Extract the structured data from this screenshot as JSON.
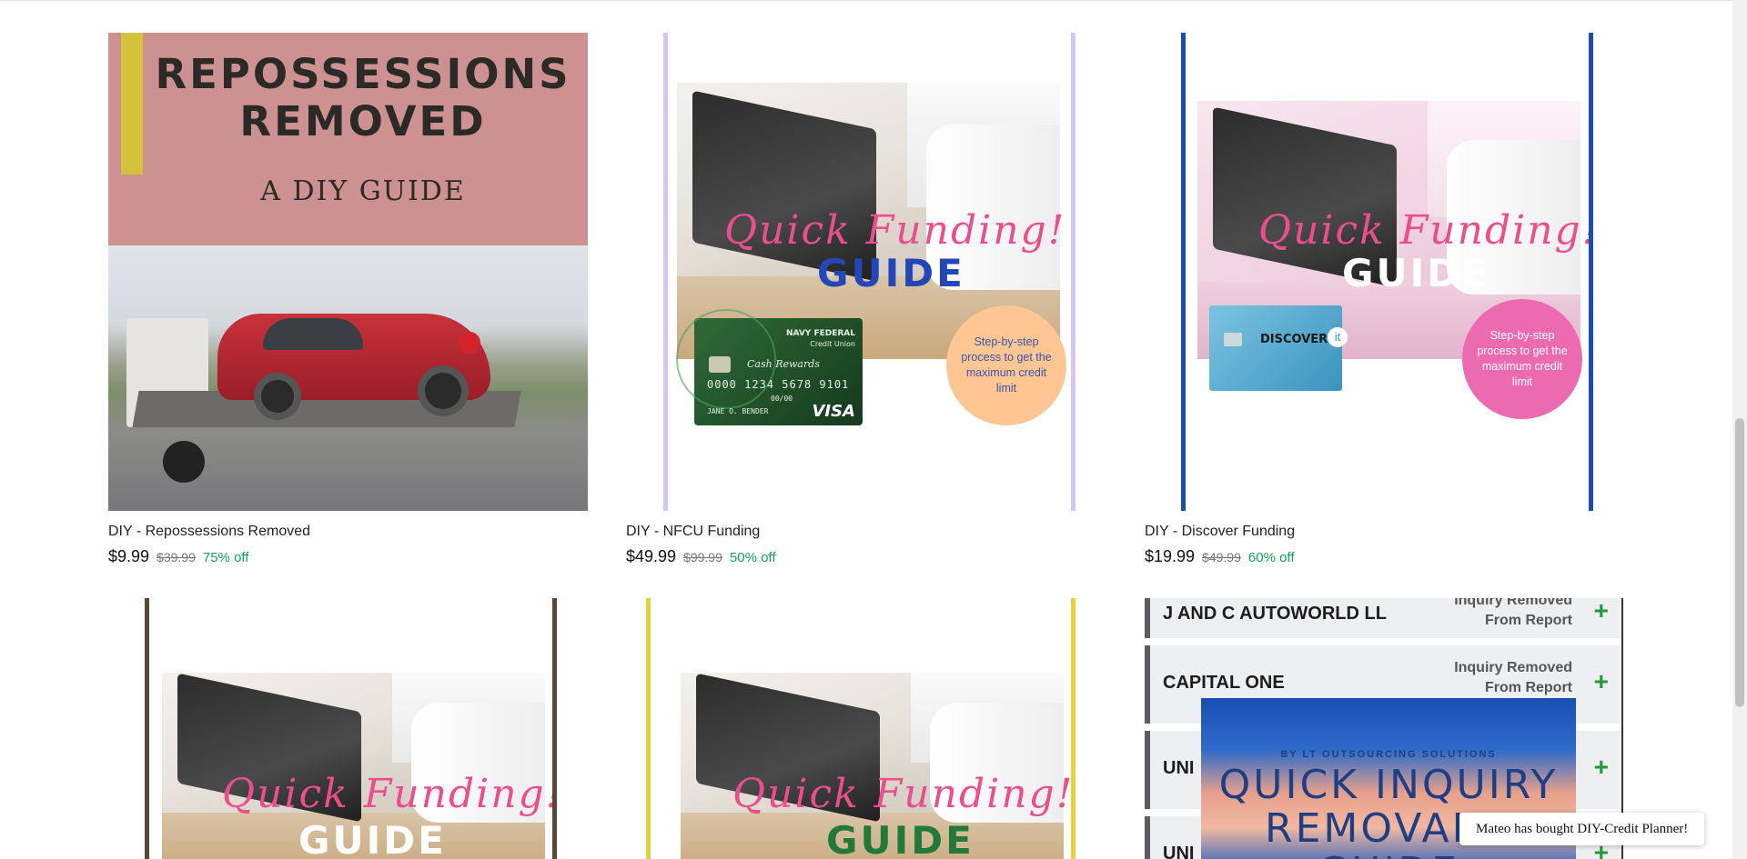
{
  "products": [
    {
      "title": "DIY - Repossessions Removed",
      "price": "$9.99",
      "old_price": "$39.99",
      "discount": "75% off",
      "cover": {
        "heading_line1": "REPOSSESSIONS",
        "heading_line2": "REMOVED",
        "subheading": "A DIY GUIDE"
      }
    },
    {
      "title": "DIY - NFCU Funding",
      "price": "$49.99",
      "old_price": "$99.99",
      "discount": "50% off",
      "cover": {
        "script": "Quick Funding!",
        "guide": "GUIDE",
        "bubble": "Step-by-step process to get the maximum credit limit",
        "card_brand": "NAVY FEDERAL",
        "card_sub": "Credit Union",
        "card_cash": "Cash Rewards",
        "card_number": "0000 1234 5678 9101",
        "card_expiry": "00/00",
        "card_holder": "JANE O. BENDER",
        "card_network": "VISA"
      }
    },
    {
      "title": "DIY - Discover Funding",
      "price": "$19.99",
      "old_price": "$49.99",
      "discount": "60% off",
      "cover": {
        "script": "Quick Funding!",
        "guide": "GUIDE",
        "bubble": "Step-by-step process to get the maximum credit limit",
        "card_brand": "DISCOVER",
        "card_suffix": "it"
      }
    },
    {
      "cover": {
        "script": "Quick Funding!",
        "guide": "GUIDE"
      }
    },
    {
      "cover": {
        "script": "Quick Funding!",
        "guide": "GUIDE"
      }
    },
    {
      "cover": {
        "rows": [
          {
            "name": "J AND C AUTOWORLD LL",
            "status_l1": "Inquiry Removed",
            "status_l2": "From Report"
          },
          {
            "name": "CAPITAL ONE",
            "status_l1": "Inquiry Removed",
            "status_l2": "From Report"
          },
          {
            "name": "UNI",
            "status_l1": "",
            "status_l2": ""
          },
          {
            "name": "UNI",
            "status_l1": "",
            "status_l2": ""
          }
        ],
        "book_byline": "BY LT OUTSOURCING SOLUTIONS",
        "book_title_l1": "QUICK INQUIRY",
        "book_title_l2": "REMOVAL",
        "book_title_l3": "GUIDE"
      }
    }
  ],
  "toast": {
    "text": "Mateo has bought DIY-Credit Planner!"
  },
  "colors": {
    "discount": "#13a556",
    "pink_bubble": "#ec6bb0",
    "peach_bubble": "#fec693",
    "nfcu_frame": "#d7c5f2",
    "discover_frame": "#1a4fa8"
  }
}
